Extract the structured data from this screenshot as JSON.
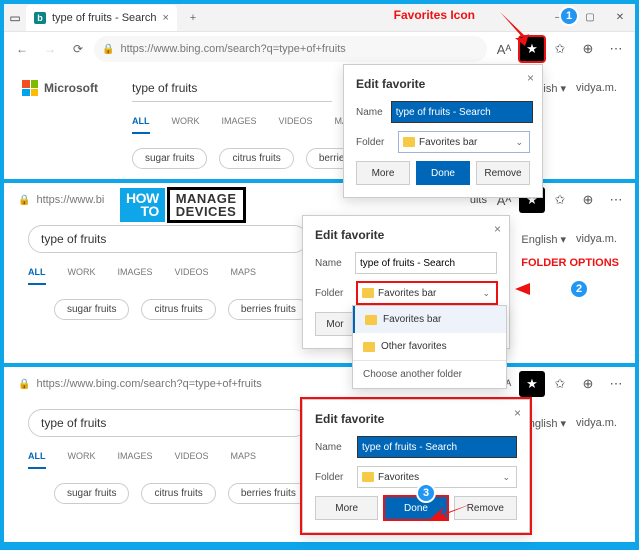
{
  "annotations": {
    "favorites_label": "Favorites Icon",
    "folder_label": "FOLDER OPTIONS",
    "step1": "1",
    "step2": "2",
    "step3": "3"
  },
  "watermark": {
    "how": "HOW",
    "to": "TO",
    "manage": "MANAGE",
    "devices": "DEVICES"
  },
  "browser": {
    "tab_title": "type of fruits - Search",
    "url_full": "https://www.bing.com/search?q=type+of+fruits",
    "url_short": "https://www.bi",
    "aa": "Aᴬ"
  },
  "header": {
    "microsoft": "Microsoft",
    "english": "English",
    "user": "vidya.m."
  },
  "search": {
    "query": "type of fruits",
    "partial": "uits"
  },
  "tabs": {
    "all": "ALL",
    "work": "WORK",
    "images": "IMAGES",
    "videos": "VIDEOS",
    "maps": "MAPS"
  },
  "chips": {
    "c1": "sugar fruits",
    "c2": "citrus fruits",
    "c3": "berries fruits"
  },
  "popup": {
    "title": "Edit favorite",
    "name_label": "Name",
    "folder_label": "Folder",
    "name_value": "type of fruits - Search",
    "folder_value": "Favorites bar",
    "folder_value_short": "Favorites",
    "more": "More",
    "done": "Done",
    "remove": "Remove"
  },
  "dropdown": {
    "opt1": "Favorites bar",
    "opt2": "Favorites bar",
    "opt3": "Other favorites",
    "choose": "Choose another folder"
  }
}
